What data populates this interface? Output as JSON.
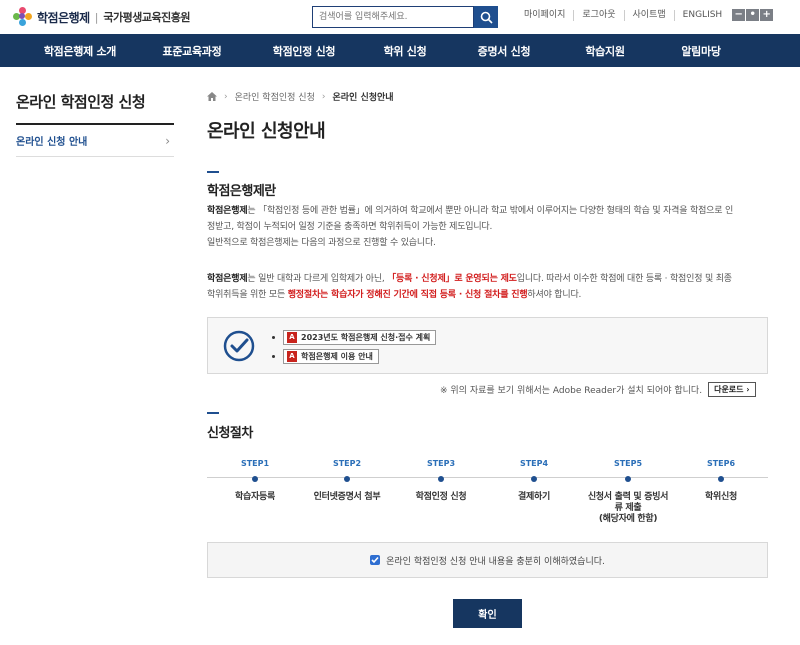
{
  "header": {
    "logo_name": "학점은행제",
    "logo_org": "국가평생교육진흥원",
    "search_placeholder": "검색어를 입력해주세요.",
    "util_links": [
      "마이페이지",
      "로그아웃",
      "사이트맵",
      "ENGLISH"
    ],
    "zoom_buttons": [
      "−",
      "•",
      "+"
    ]
  },
  "gnb": {
    "items": [
      "학점은행제 소개",
      "표준교육과정",
      "학점인정 신청",
      "학위 신청",
      "증명서 신청",
      "학습지원",
      "알림마당"
    ]
  },
  "sidebar": {
    "title": "온라인 학점인정 신청",
    "items": [
      {
        "label": "온라인 신청 안내",
        "chevron": "›"
      }
    ]
  },
  "breadcrumb": {
    "items": [
      "온라인 학점인정 신청",
      "온라인 신청안내"
    ],
    "separator": "›"
  },
  "page_title": "온라인 신청안내",
  "section1": {
    "title": "학점은행제란",
    "p1": {
      "lead": "학점은행제",
      "line1": "는 「학점인정 등에 관한 법률」에 의거하여 학교에서 뿐만 아니라 학교 밖에서 이루어지는 다양한 형태의 학습 및 자격을 학점으로 인",
      "line2": "정받고, 학점이 누적되어 일정 기준을 충족하면 학위취득이 가능한 제도입니다.",
      "line3": "일반적으로 학점은행제는 다음의 과정으로 진행할 수 있습니다."
    },
    "p2": {
      "lead": "학점은행제",
      "part1": "는 일반 대학과 다르게 입학제가 아닌, ",
      "red1": "「등록 · 신청제」로 운영되는 제도",
      "part2": "입니다. 따라서 이수한 학점에 대한 등록 · 학점인정 및 최종",
      "part3": "학위취득을 위한 모든 ",
      "red2": "행정절차는 학습자가 정해진 기간에 직접 등록 · 신청 절차를 진행",
      "part4": "하셔야 합니다."
    }
  },
  "documents": {
    "items": [
      "2023년도 학점은행제 신청·접수 계획",
      "학점은행제 이용 안내"
    ],
    "pdf_label": "A"
  },
  "adobe": {
    "note": "※ 위의 자료를 보기 위해서는 Adobe Reader가 설치 되어야 합니다.",
    "download_label": "다운로드 ›"
  },
  "section2": {
    "title": "신청절차",
    "steps": [
      {
        "num": "STEP1",
        "label": "학습자등록"
      },
      {
        "num": "STEP2",
        "label": "인터넷증명서 첨부"
      },
      {
        "num": "STEP3",
        "label": "학점인정 신청"
      },
      {
        "num": "STEP4",
        "label": "결제하기"
      },
      {
        "num": "STEP5",
        "label": "신청서 출력 및 증빙서\n류 제출\n(해당자에 한함)"
      },
      {
        "num": "STEP6",
        "label": "학위신청"
      }
    ]
  },
  "agree": {
    "text": "온라인 학점인정 신청 안내 내용을 충분히 이해하였습니다.",
    "checked": true
  },
  "confirm_label": "확인",
  "colors": {
    "navy": "#163660",
    "accent": "#1f4f8f",
    "red": "#d21d1d"
  }
}
